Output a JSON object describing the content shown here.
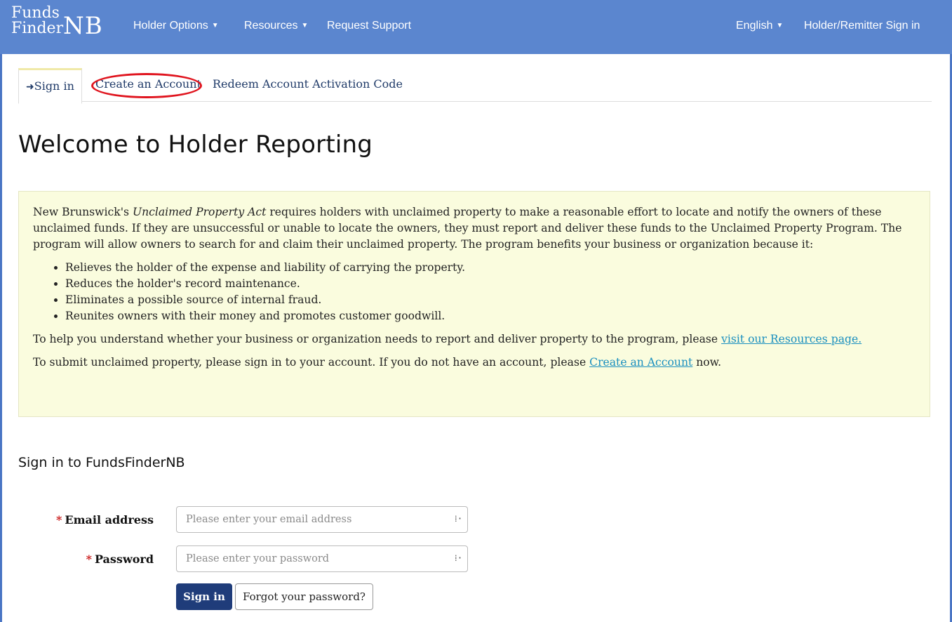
{
  "brand": {
    "line1": "Funds",
    "line2": "Finder",
    "suffix": "NB"
  },
  "nav": {
    "holder_options": "Holder Options",
    "resources": "Resources",
    "request_support": "Request Support",
    "language": "English",
    "sign_in": "Holder/Remitter Sign in"
  },
  "tabs": [
    {
      "label": "Sign in",
      "icon": "sign-in-icon",
      "active": true
    },
    {
      "label": "Create an Account",
      "highlighted": true
    },
    {
      "label": "Redeem Account Activation Code"
    }
  ],
  "page_title": "Welcome to Holder Reporting",
  "info": {
    "intro_part1": "New Brunswick's ",
    "intro_act": "Unclaimed Property Act",
    "intro_part2": " requires holders with unclaimed property to make a reasonable effort to locate and notify the owners of these unclaimed funds. If they are unsuccessful or unable to locate the owners, they must report and deliver these funds to the Unclaimed Property Program. The program will allow owners to search for and claim their unclaimed property. The program benefits your business or organization because it:",
    "benefits": [
      "Relieves the holder of the expense and liability of carrying the property.",
      "Reduces the holder's record maintenance.",
      "Eliminates a possible source of internal fraud.",
      "Reunites owners with their money and promotes customer goodwill."
    ],
    "help_text": "To help you understand whether your business or organization needs to report and deliver property to the program, please ",
    "help_link": "visit our Resources page.",
    "submit_text": "To submit unclaimed property, please sign in to your account. If you do not have an account, please ",
    "submit_link": "Create an Account",
    "submit_end": " now."
  },
  "signin": {
    "heading": "Sign in to FundsFinderNB",
    "required_marker": "*",
    "email_label": "Email address",
    "email_placeholder": "Please enter your email address",
    "email_value": "",
    "password_label": "Password",
    "password_placeholder": "Please enter your password",
    "password_value": "",
    "signin_button": "Sign in",
    "forgot_button": "Forgot your password?"
  },
  "colors": {
    "navbar": "#5b86cf",
    "info_bg": "#fafcde",
    "primary": "#1f3c7a",
    "highlight": "#e0141e"
  }
}
